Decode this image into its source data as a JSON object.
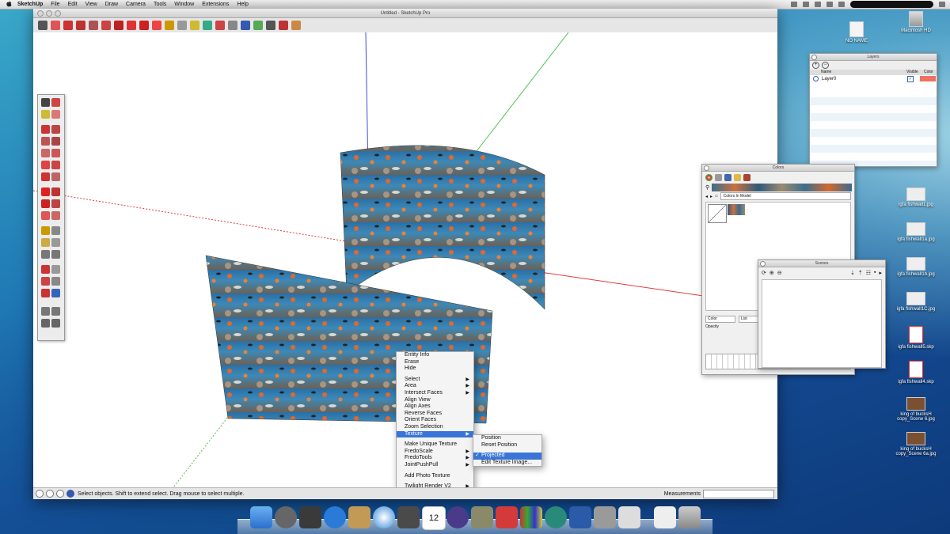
{
  "menubar": {
    "apple": "",
    "app_name": "SketchUp",
    "items": [
      "File",
      "Edit",
      "View",
      "Draw",
      "Camera",
      "Tools",
      "Window",
      "Extensions",
      "Help"
    ]
  },
  "window": {
    "title": "Untitled - SketchUp Pro"
  },
  "statusbar": {
    "hint": "Select objects. Shift to extend select. Drag mouse to select multiple.",
    "measurements_label": "Measurements"
  },
  "context_menu": {
    "items": [
      "Entity Info",
      "Erase",
      "Hide",
      "",
      "Select",
      "Area",
      "Intersect Faces",
      "Align View",
      "Align Axes",
      "Reverse Faces",
      "Orient Faces",
      "Zoom Selection",
      "Texture",
      "",
      "Make Unique Texture",
      "FredoScale",
      "FredoTools",
      "JointPushPull",
      "",
      "Add Photo Texture",
      "",
      "Twilight Render V2"
    ],
    "submenu_items": [
      "Select",
      "Area",
      "Intersect Faces",
      "Texture",
      "FredoScale",
      "FredoTools",
      "JointPushPull",
      "Twilight Render V2"
    ],
    "highlighted": "Texture"
  },
  "texture_submenu": {
    "items": [
      "Position",
      "Reset Position",
      "",
      "Projected",
      "Edit Texture Image..."
    ],
    "checked": "Projected",
    "check_mark": "✓"
  },
  "layers_panel": {
    "title": "Layers",
    "col_name": "Name",
    "col_visible": "Visible",
    "col_color": "Color",
    "row_name": "Layer0",
    "row_color": "#f07064"
  },
  "colors_panel": {
    "title": "Colors",
    "dropdown": "Colors In Model",
    "bottom_select": "Color",
    "bottom_list": "List",
    "opacity_label": "Opacity"
  },
  "scenes_panel": {
    "title": "Scenes"
  },
  "desktop_icons": [
    {
      "label": "Macintosh HD"
    },
    {
      "label": "NO NAME"
    },
    {
      "label": "igfa fishwall1.jpg"
    },
    {
      "label": "igfa fishwall1a.jpg"
    },
    {
      "label": "igfa fishwall1b.jpg"
    },
    {
      "label": "igfa fishwall1C.jpg"
    },
    {
      "label": "igfa fishwall5.skp"
    },
    {
      "label": "igfa fishwall4.skp"
    },
    {
      "label": "king of bucksH copy_Scene 6.jpg"
    },
    {
      "label": "king of bucksH copy_Scene 6a.jpg"
    }
  ],
  "dock_calendar_day": "12",
  "colors": {
    "highlight": "#3875d7",
    "axis_red": "#e53b3b",
    "axis_green": "#4fc24f",
    "axis_blue": "#3a4fd8"
  }
}
